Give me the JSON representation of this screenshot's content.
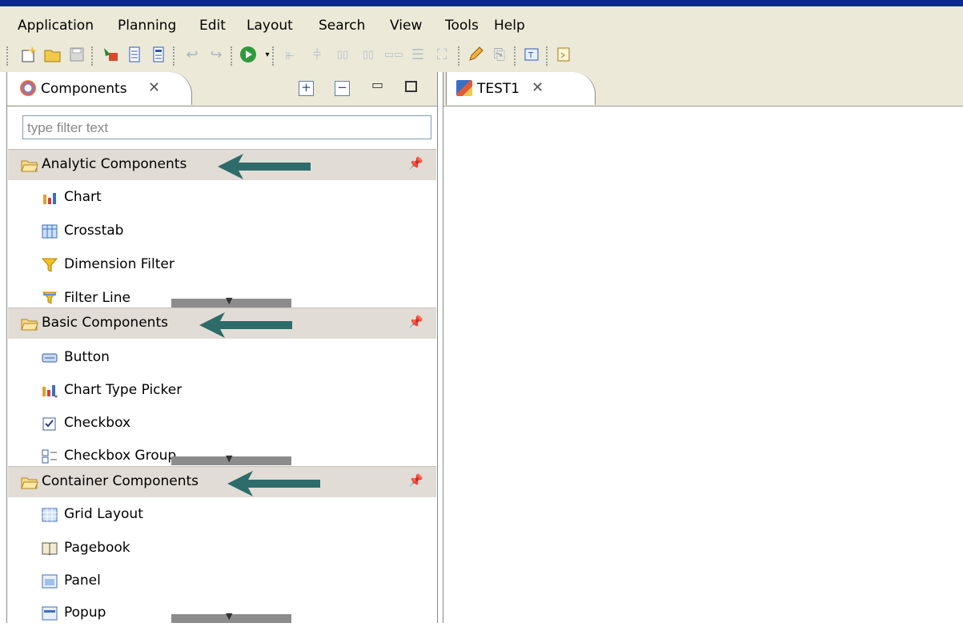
{
  "menu": [
    "Application",
    "Planning",
    "Edit",
    "Layout",
    "Search",
    "View",
    "Tools",
    "Help"
  ],
  "components_tab": {
    "label": "Components"
  },
  "filter": {
    "placeholder": "type filter text"
  },
  "drawers": [
    {
      "label": "Analytic Components",
      "items": [
        {
          "label": "Chart",
          "icon": "chart-icon"
        },
        {
          "label": "Crosstab",
          "icon": "crosstab-icon"
        },
        {
          "label": "Dimension Filter",
          "icon": "funnel-icon"
        },
        {
          "label": "Filter Line",
          "icon": "filter-line-icon"
        }
      ]
    },
    {
      "label": "Basic Components",
      "items": [
        {
          "label": "Button",
          "icon": "button-icon"
        },
        {
          "label": "Chart Type Picker",
          "icon": "chart-type-picker-icon"
        },
        {
          "label": "Checkbox",
          "icon": "checkbox-icon"
        },
        {
          "label": "Checkbox Group",
          "icon": "checkbox-group-icon"
        }
      ]
    },
    {
      "label": "Container Components",
      "items": [
        {
          "label": "Grid Layout",
          "icon": "grid-layout-icon"
        },
        {
          "label": "Pagebook",
          "icon": "pagebook-icon"
        },
        {
          "label": "Panel",
          "icon": "panel-icon"
        },
        {
          "label": "Popup",
          "icon": "popup-icon"
        }
      ]
    }
  ],
  "editor_tab": {
    "label": "TEST1"
  },
  "colors": {
    "accent_arrow": "#2e6b6b",
    "drawer_header": "#e2dcd6",
    "chrome": "#ece9d8"
  }
}
